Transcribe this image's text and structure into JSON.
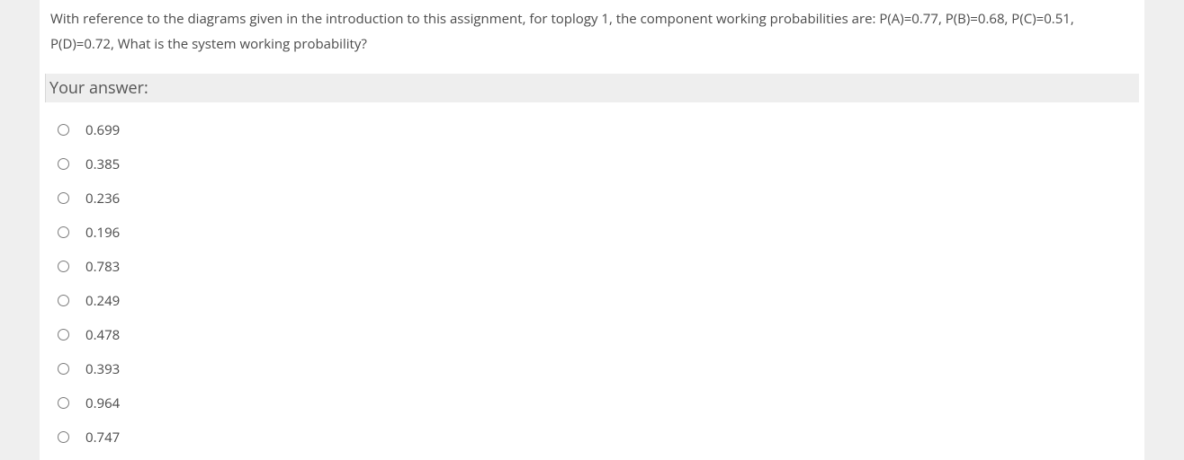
{
  "question": {
    "text": "With reference to the diagrams given in the introduction to this assignment, for toplogy 1, the component working probabilities are: P(A)=0.77, P(B)=0.68, P(C)=0.51, P(D)=0.72, What is the system working probability?"
  },
  "answer_header": "Your answer:",
  "options": [
    {
      "label": "0.699"
    },
    {
      "label": "0.385"
    },
    {
      "label": "0.236"
    },
    {
      "label": "0.196"
    },
    {
      "label": "0.783"
    },
    {
      "label": "0.249"
    },
    {
      "label": "0.478"
    },
    {
      "label": "0.393"
    },
    {
      "label": "0.964"
    },
    {
      "label": "0.747"
    }
  ]
}
